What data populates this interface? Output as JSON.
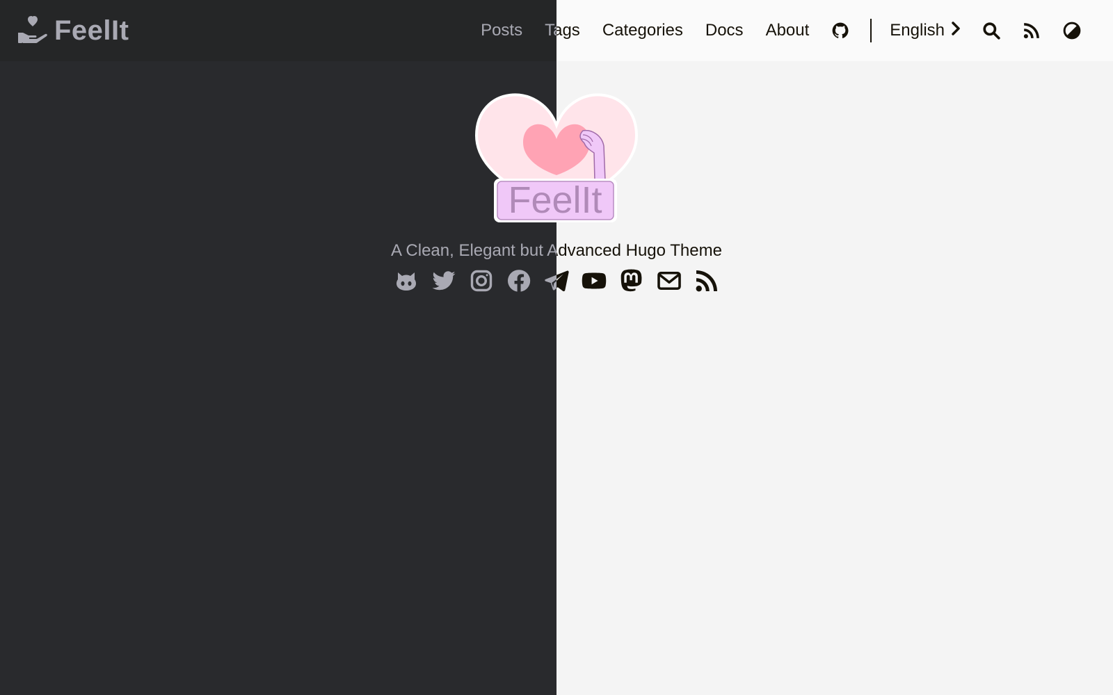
{
  "site": {
    "brand": "FeelIt",
    "subtitle": "A Clean, Elegant but Advanced Hugo Theme",
    "logo_text": "FeelIt"
  },
  "nav": {
    "links": [
      "Posts",
      "Tags",
      "Categories",
      "Docs",
      "About"
    ],
    "language": "English",
    "icons": [
      "github-icon",
      "search-icon",
      "rss-icon",
      "theme-switch-icon"
    ]
  },
  "social": [
    "github-icon",
    "twitter-icon",
    "instagram-icon",
    "facebook-icon",
    "telegram-icon",
    "youtube-icon",
    "mastodon-icon",
    "email-icon",
    "rss-icon"
  ],
  "colors": {
    "dark_bg": "#292a2d",
    "dark_header": "#252627",
    "dark_text": "#a9a9b3",
    "light_bg": "#f4f4f4",
    "light_header": "#fafafa",
    "light_text": "#161209",
    "heart_outer": "#ffe4ea",
    "heart_inner": "#ffa3b4",
    "logo_box": "#f0c8f8",
    "logo_text": "#b08ab8"
  }
}
